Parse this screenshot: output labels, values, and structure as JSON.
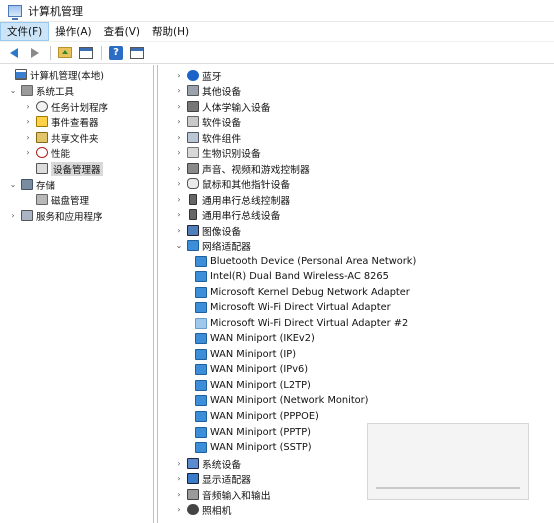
{
  "window": {
    "title": "计算机管理"
  },
  "menu": {
    "items": [
      "文件(F)",
      "操作(A)",
      "查看(V)",
      "帮助(H)"
    ]
  },
  "left_tree": [
    {
      "label": "计算机管理(本地)",
      "expander": "",
      "icon": "computer-icon"
    },
    {
      "label": "系统工具",
      "expander": "⌄",
      "icon": "tools-icon"
    },
    {
      "label": "任务计划程序",
      "expander": "›",
      "icon": "clock-icon"
    },
    {
      "label": "事件查看器",
      "expander": "›",
      "icon": "event-viewer-icon"
    },
    {
      "label": "共享文件夹",
      "expander": "›",
      "icon": "shared-folder-icon"
    },
    {
      "label": "性能",
      "expander": "›",
      "icon": "performance-icon"
    },
    {
      "label": "设备管理器",
      "expander": "",
      "icon": "device-manager-icon"
    },
    {
      "label": "存储",
      "expander": "⌄",
      "icon": "storage-icon"
    },
    {
      "label": "磁盘管理",
      "expander": "",
      "icon": "disk-icon"
    },
    {
      "label": "服务和应用程序",
      "expander": "›",
      "icon": "services-icon"
    }
  ],
  "device_tree": [
    {
      "label": "蓝牙",
      "expander": "›",
      "icon": "bluetooth-icon"
    },
    {
      "label": "其他设备",
      "expander": "›",
      "icon": "other-devices-icon"
    },
    {
      "label": "人体学输入设备",
      "expander": "›",
      "icon": "human-interface-icon"
    },
    {
      "label": "软件设备",
      "expander": "›",
      "icon": "software-device-icon"
    },
    {
      "label": "软件组件",
      "expander": "›",
      "icon": "software-component-icon"
    },
    {
      "label": "生物识别设备",
      "expander": "›",
      "icon": "biometric-icon"
    },
    {
      "label": "声音、视频和游戏控制器",
      "expander": "›",
      "icon": "sound-icon"
    },
    {
      "label": "鼠标和其他指针设备",
      "expander": "›",
      "icon": "mouse-icon"
    },
    {
      "label": "通用串行总线控制器",
      "expander": "›",
      "icon": "usb-icon"
    },
    {
      "label": "通用串行总线设备",
      "expander": "›",
      "icon": "usb-icon"
    },
    {
      "label": "图像设备",
      "expander": "›",
      "icon": "imaging-icon"
    },
    {
      "label": "网络适配器",
      "expander": "⌄",
      "icon": "network-adapter-icon"
    },
    {
      "label": "Bluetooth Device (Personal Area Network)",
      "expander": "",
      "icon": "network-adapter-icon"
    },
    {
      "label": "Intel(R) Dual Band Wireless-AC 8265",
      "expander": "",
      "icon": "network-adapter-icon"
    },
    {
      "label": "Microsoft Kernel Debug Network Adapter",
      "expander": "",
      "icon": "network-adapter-icon"
    },
    {
      "label": "Microsoft Wi-Fi Direct Virtual Adapter",
      "expander": "",
      "icon": "network-adapter-icon"
    },
    {
      "label": "Microsoft Wi-Fi Direct Virtual Adapter #2",
      "expander": "",
      "icon": "network-adapter-disabled-icon"
    },
    {
      "label": "WAN Miniport (IKEv2)",
      "expander": "",
      "icon": "network-adapter-icon"
    },
    {
      "label": "WAN Miniport (IP)",
      "expander": "",
      "icon": "network-adapter-icon"
    },
    {
      "label": "WAN Miniport (IPv6)",
      "expander": "",
      "icon": "network-adapter-icon"
    },
    {
      "label": "WAN Miniport (L2TP)",
      "expander": "",
      "icon": "network-adapter-icon"
    },
    {
      "label": "WAN Miniport (Network Monitor)",
      "expander": "",
      "icon": "network-adapter-icon"
    },
    {
      "label": "WAN Miniport (PPPOE)",
      "expander": "",
      "icon": "network-adapter-icon"
    },
    {
      "label": "WAN Miniport (PPTP)",
      "expander": "",
      "icon": "network-adapter-icon"
    },
    {
      "label": "WAN Miniport (SSTP)",
      "expander": "",
      "icon": "network-adapter-icon"
    },
    {
      "label": "系统设备",
      "expander": "›",
      "icon": "system-devices-icon"
    },
    {
      "label": "显示适配器",
      "expander": "›",
      "icon": "display-adapter-icon"
    },
    {
      "label": "音频输入和输出",
      "expander": "›",
      "icon": "audio-io-icon"
    },
    {
      "label": "照相机",
      "expander": "›",
      "icon": "camera-icon"
    }
  ]
}
